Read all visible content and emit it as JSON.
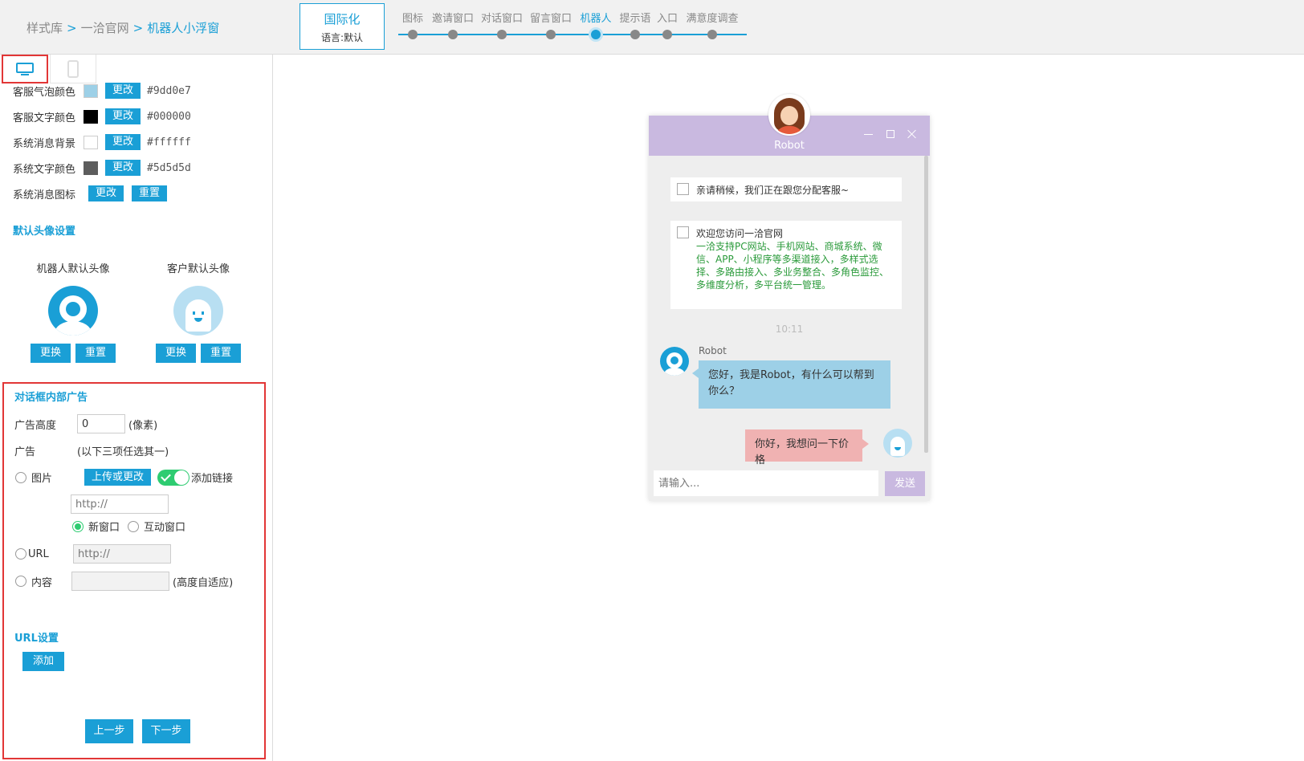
{
  "breadcrumb": [
    "样式库",
    "一洽官网",
    "机器人小浮窗"
  ],
  "breadcrumb_sep": ">",
  "i18n": {
    "title": "国际化",
    "lang": "语言:默认"
  },
  "steps": [
    {
      "label": "图标",
      "active": false
    },
    {
      "label": "邀请窗口",
      "active": false
    },
    {
      "label": "对话窗口",
      "active": false
    },
    {
      "label": "留言窗口",
      "active": false
    },
    {
      "label": "机器人",
      "active": true
    },
    {
      "label": "提示语",
      "active": false
    },
    {
      "label": "入口",
      "active": false
    },
    {
      "label": "满意度调查",
      "active": false
    }
  ],
  "colors": {
    "accent": "#1a9fd6",
    "agent_bubble": "#9dd0e7",
    "agent_text": "#000000",
    "sys_bg": "#ffffff",
    "sys_text": "#5d5d5d",
    "header_purple": "#c9b9e0",
    "customer_bubble": "#f0b2b2",
    "red_highlight": "#e23636"
  },
  "color_settings": [
    {
      "label": "客服气泡颜色",
      "btn": "更改",
      "hex": "#9dd0e7",
      "swatch": "#9dd0e7"
    },
    {
      "label": "客服文字颜色",
      "btn": "更改",
      "hex": "#000000",
      "swatch": "#000000"
    },
    {
      "label": "系统消息背景",
      "btn": "更改",
      "hex": "#ffffff",
      "swatch": "#ffffff"
    },
    {
      "label": "系统文字颜色",
      "btn": "更改",
      "hex": "#5d5d5d",
      "swatch": "#5d5d5d"
    }
  ],
  "sys_icon": {
    "label": "系统消息图标",
    "change": "更改",
    "reset": "重置"
  },
  "avatar_section": {
    "title": "默认头像设置",
    "robot": {
      "caption": "机器人默认头像",
      "change": "更换",
      "reset": "重置"
    },
    "customer": {
      "caption": "客户默认头像",
      "change": "更换",
      "reset": "重置"
    }
  },
  "ad": {
    "title": "对话框内部广告",
    "height_label": "广告高度",
    "height_value": "0",
    "height_unit": "(像素)",
    "ad_label": "广告",
    "ad_hint": "(以下三项任选其一)",
    "image_label": "图片",
    "upload_btn": "上传或更改",
    "add_link": "添加链接",
    "link_placeholder": "http://",
    "new_window": "新窗口",
    "interactive_window": "互动窗口",
    "url_label": "URL",
    "url_placeholder": "http://",
    "content_label": "内容",
    "content_hint": "(高度自适应)"
  },
  "url_settings": {
    "title": "URL设置",
    "add": "添加"
  },
  "nav": {
    "prev": "上一步",
    "next": "下一步"
  },
  "chat": {
    "title": "Robot",
    "sys1": "亲请稍候，我们正在跟您分配客服~",
    "sys2_title": "欢迎您访问一洽官网",
    "sys2_body": "一洽支持PC网站、手机网站、商城系统、微信、APP、小程序等多渠道接入，多样式选择、多路由接入、多业务整合、多角色监控、多维度分析，多平台统一管理。",
    "time": "10:11",
    "sender": "Robot",
    "agent_msg": "您好，我是Robot，有什么可以帮到你么？",
    "customer_msg": "你好，我想问一下价格",
    "input_placeholder": "请输入...",
    "send": "发送"
  }
}
